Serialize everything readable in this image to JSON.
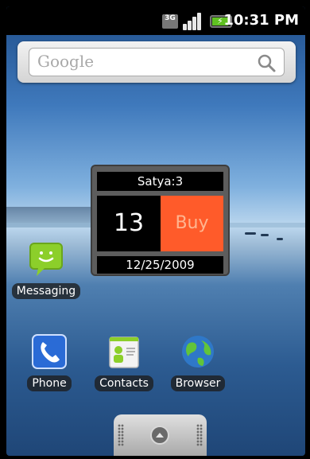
{
  "status_bar": {
    "network": "3G",
    "time": "10:31 PM"
  },
  "search_widget": {
    "placeholder": "Google"
  },
  "deal_widget": {
    "user": "Satya:3",
    "count": "13",
    "action": "Buy",
    "date": "12/25/2009",
    "colors": {
      "action_bg": "#ff5b2a",
      "panel_bg": "#000000"
    }
  },
  "home_apps": [
    {
      "label": "Messaging",
      "icon": "messaging-icon"
    },
    {
      "label": "Phone",
      "icon": "phone-icon"
    },
    {
      "label": "Contacts",
      "icon": "contacts-icon"
    },
    {
      "label": "Browser",
      "icon": "browser-icon"
    }
  ],
  "app_drawer": {
    "icon": "app-drawer-up-icon"
  }
}
